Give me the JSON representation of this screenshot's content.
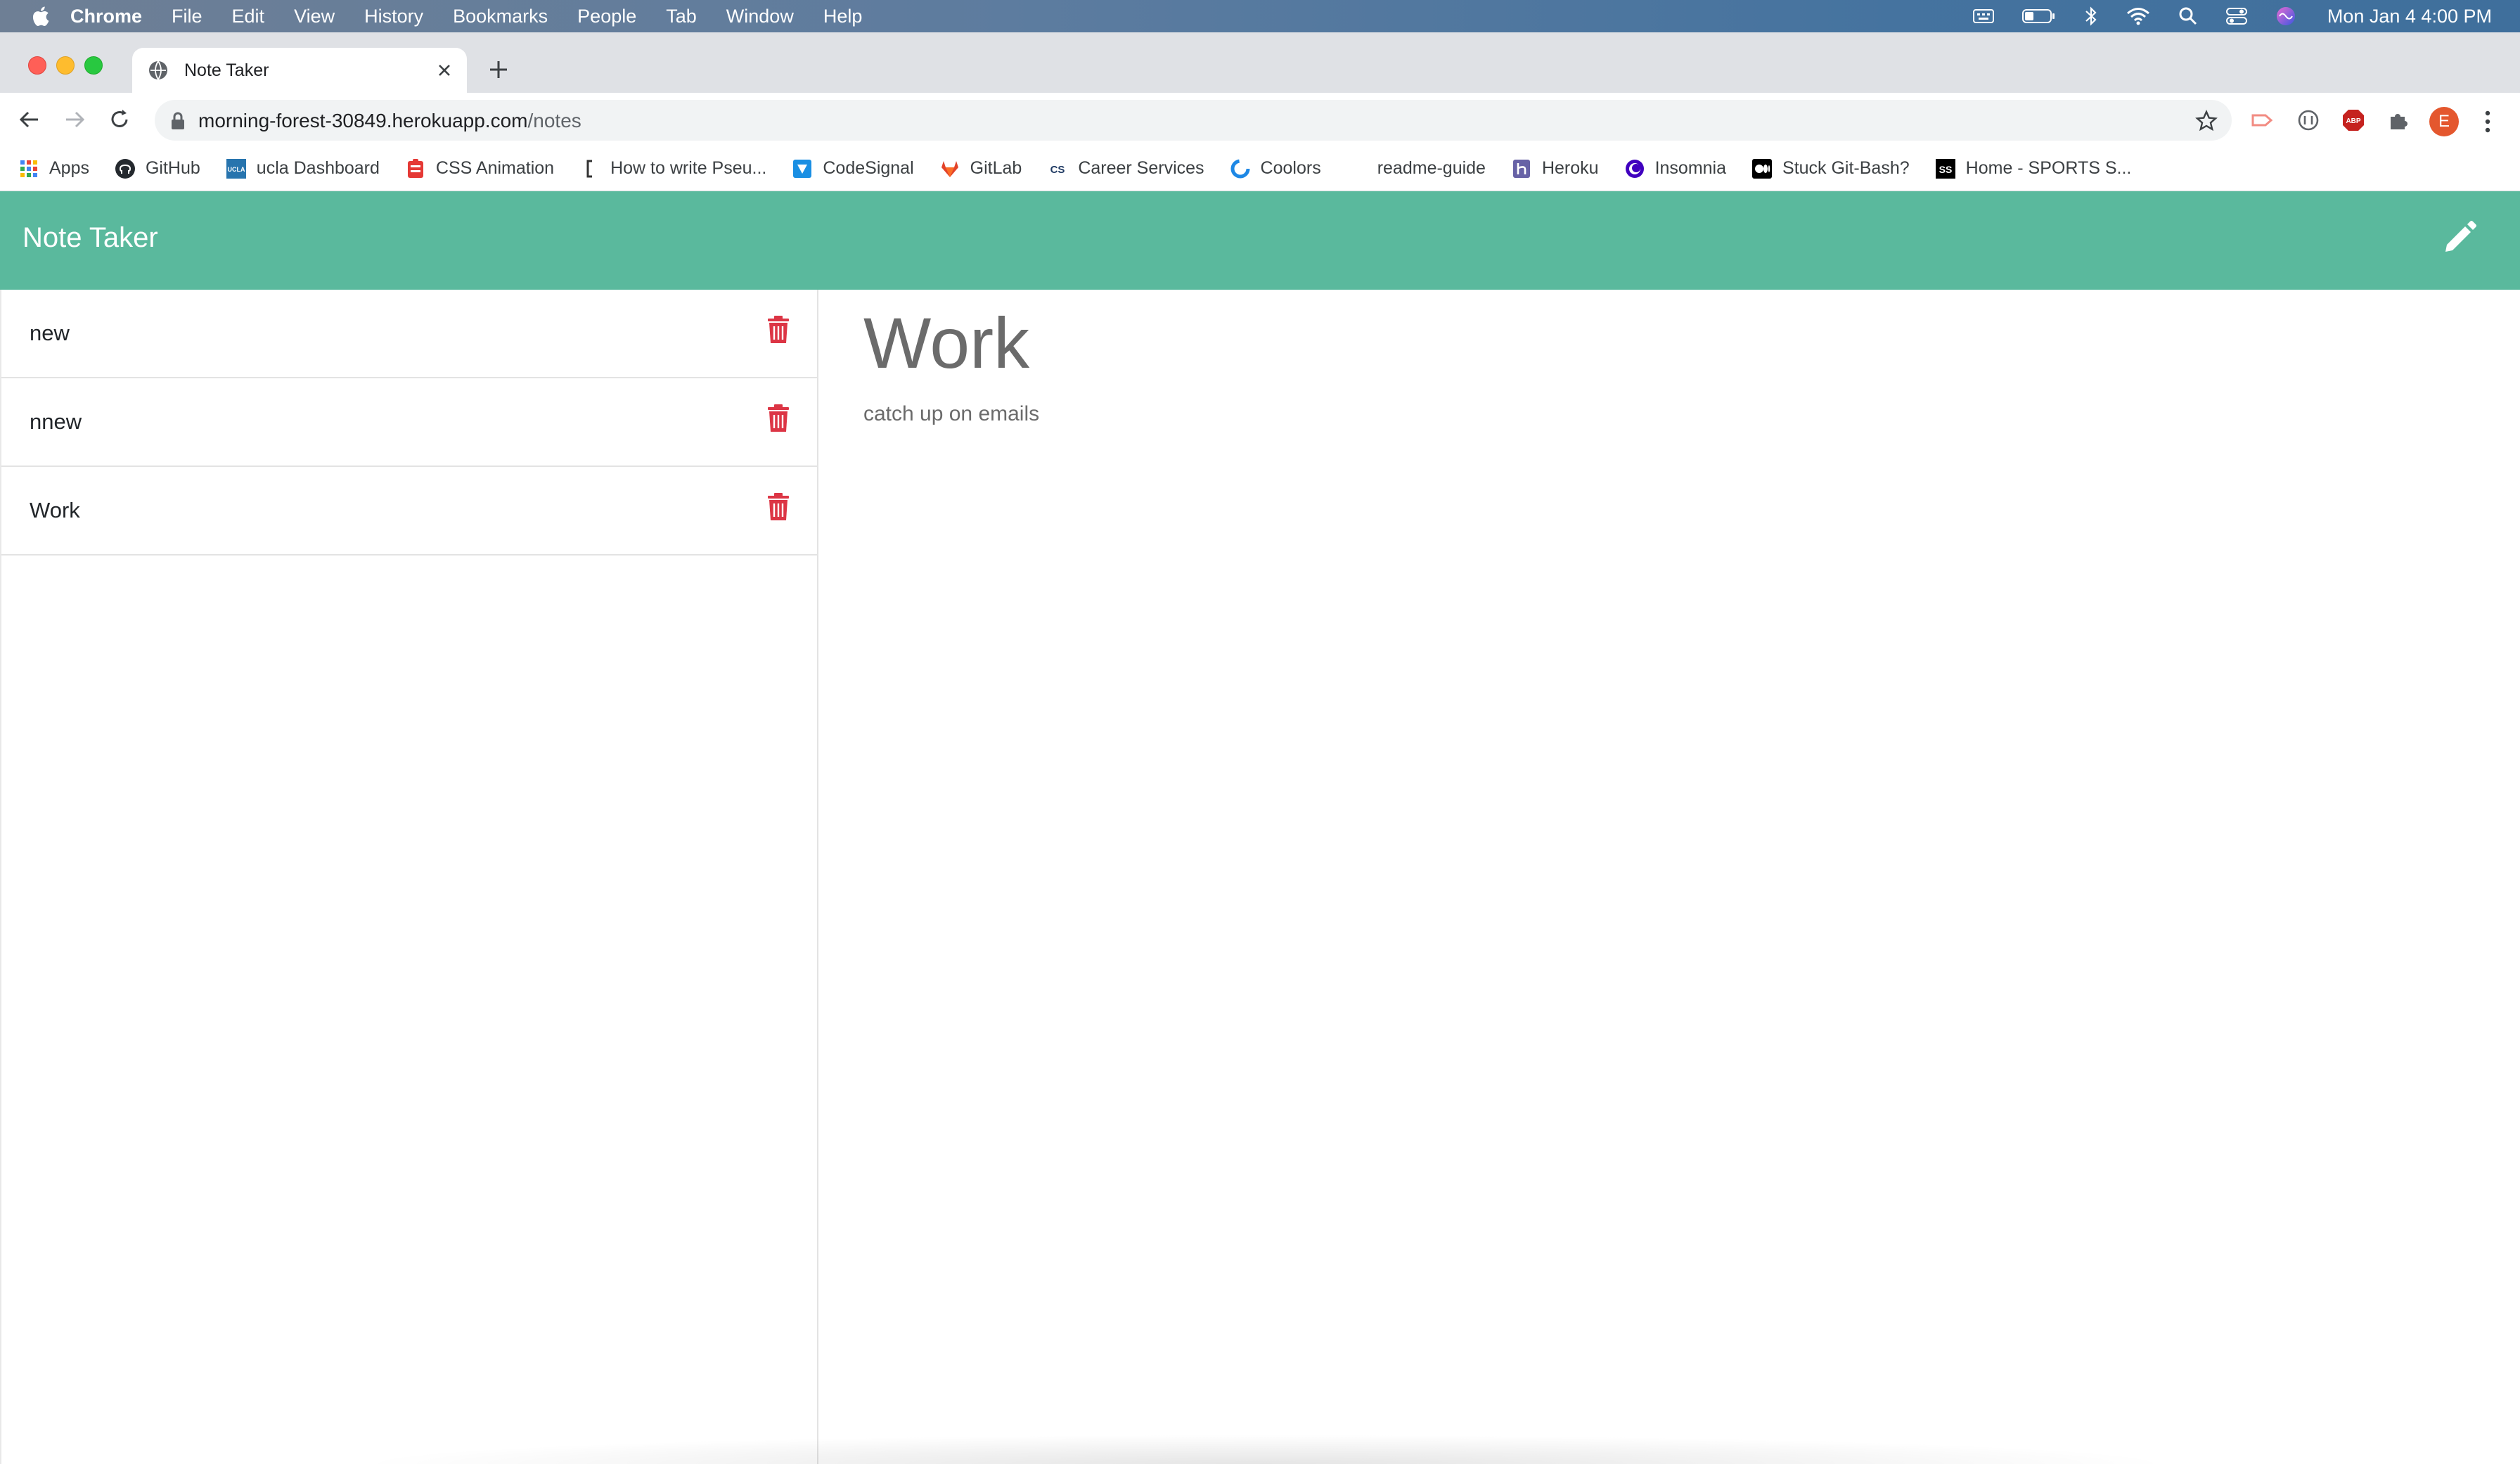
{
  "menubar": {
    "app_name": "Chrome",
    "items": [
      "File",
      "Edit",
      "View",
      "History",
      "Bookmarks",
      "People",
      "Tab",
      "Window",
      "Help"
    ],
    "clock": "Mon Jan 4  4:00 PM"
  },
  "browser": {
    "tab_title": "Note Taker",
    "url_host": "morning-forest-30849.herokuapp.com",
    "url_path": "/notes",
    "profile_initial": "E",
    "bookmarks": [
      {
        "label": "Apps",
        "icon": "apps-grid-icon",
        "color": "#4285f4"
      },
      {
        "label": "GitHub",
        "icon": "github-icon",
        "color": "#24292e"
      },
      {
        "label": "ucla Dashboard",
        "icon": "ucla-icon",
        "color": "#2774ae"
      },
      {
        "label": "CSS Animation",
        "icon": "css-animation-icon",
        "color": "#e53935"
      },
      {
        "label": "How to write Pseu...",
        "icon": "bracket-icon",
        "color": "#333333"
      },
      {
        "label": "CodeSignal",
        "icon": "codesignal-icon",
        "color": "#1a8fe3"
      },
      {
        "label": "GitLab",
        "icon": "gitlab-icon",
        "color": "#e24329"
      },
      {
        "label": "Career Services",
        "icon": "career-services-icon",
        "color": "#1f3a63"
      },
      {
        "label": "Coolors",
        "icon": "coolors-icon",
        "color": "#1e88e5"
      },
      {
        "label": "readme-guide",
        "icon": "readme-icon",
        "color": "#ffffff"
      },
      {
        "label": "Heroku",
        "icon": "heroku-icon",
        "color": "#6762a6"
      },
      {
        "label": "Insomnia",
        "icon": "insomnia-icon",
        "color": "#4000bf"
      },
      {
        "label": "Stuck Git-Bash?",
        "icon": "medium-icon",
        "color": "#000000"
      },
      {
        "label": "Home - SPORTS S...",
        "icon": "ss-icon",
        "color": "#000000"
      }
    ]
  },
  "app": {
    "brand": "Note Taker",
    "accent_color": "#5ab99d",
    "delete_color": "#dc3545",
    "notes": [
      {
        "title": "new"
      },
      {
        "title": "nnew"
      },
      {
        "title": "Work"
      }
    ],
    "active_note": {
      "title": "Work",
      "text": "catch up on emails"
    }
  }
}
